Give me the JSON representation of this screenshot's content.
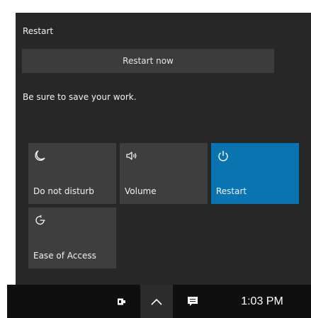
{
  "flyout": {
    "title": "Restart",
    "restart_now_label": "Restart now",
    "message": "Be sure to save your work."
  },
  "quick_actions": [
    {
      "label": "Do not disturb",
      "icon": "moon-icon",
      "active": false
    },
    {
      "label": "Volume",
      "icon": "speaker-icon",
      "active": false
    },
    {
      "label": "Restart",
      "icon": "power-icon",
      "active": true
    },
    {
      "label": "Ease of Access",
      "icon": "ease-of-access-icon",
      "active": false
    }
  ],
  "taskbar": {
    "time": "1:03 PM",
    "icons": [
      "battery-icon",
      "chevron-up-icon",
      "action-center-icon"
    ]
  },
  "colors": {
    "panel_bg": "#272727",
    "tile_bg": "#3e3e3e",
    "accent": "#0a74b0",
    "taskbar_bg": "#0f0f0f"
  }
}
